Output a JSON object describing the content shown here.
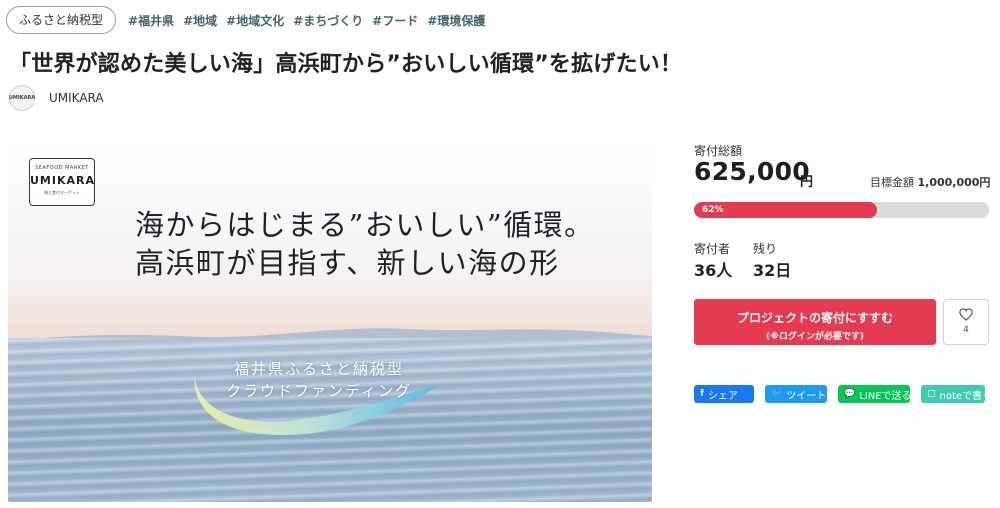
{
  "header": {
    "type_badge": "ふるさと納税型",
    "tags": [
      "#福井県",
      "#地域",
      "#地域文化",
      "#まちづくり",
      "#フード",
      "#環境保護"
    ]
  },
  "project": {
    "title": "「世界が認めた美しい海」高浜町から”おいしい循環”を拡げたい！",
    "organization": "UMIKARA",
    "org_logo_text": "UMIKARA"
  },
  "hero": {
    "logo_sub": "SEAFOOD MARKET",
    "logo_main": "UMIKARA",
    "logo_sub2": "海と食のマーケット",
    "headline_line1": "海からはじまる”おいしい”循環。",
    "headline_line2": "高浜町が目指す、新しい海の形",
    "sub_line1": "福井県ふるさと納税型",
    "sub_line2": "クラウドファンディング"
  },
  "stats": {
    "raised_label": "寄付総額",
    "raised_amount": "625,000",
    "raised_unit": "円",
    "goal_label": "目標金額",
    "goal_amount": "1,000,000円",
    "progress_percent": 62,
    "progress_label": "62%",
    "backers_label": "寄付者",
    "backers_value": "36人",
    "days_label": "残り",
    "days_value": "32日"
  },
  "actions": {
    "donate_label": "プロジェクトの寄付にすすむ",
    "donate_note": "(※ログインが必要です)",
    "favorite_count": "4"
  },
  "share": {
    "facebook": "シェア",
    "twitter": "ツイート",
    "line": "LINEで送る",
    "note": "noteで書く"
  },
  "colors": {
    "accent": "#e63a50",
    "tag": "#3f6672",
    "facebook": "#1877f2",
    "twitter": "#1d9bf0",
    "line": "#06c755",
    "note": "#41c9b4"
  }
}
